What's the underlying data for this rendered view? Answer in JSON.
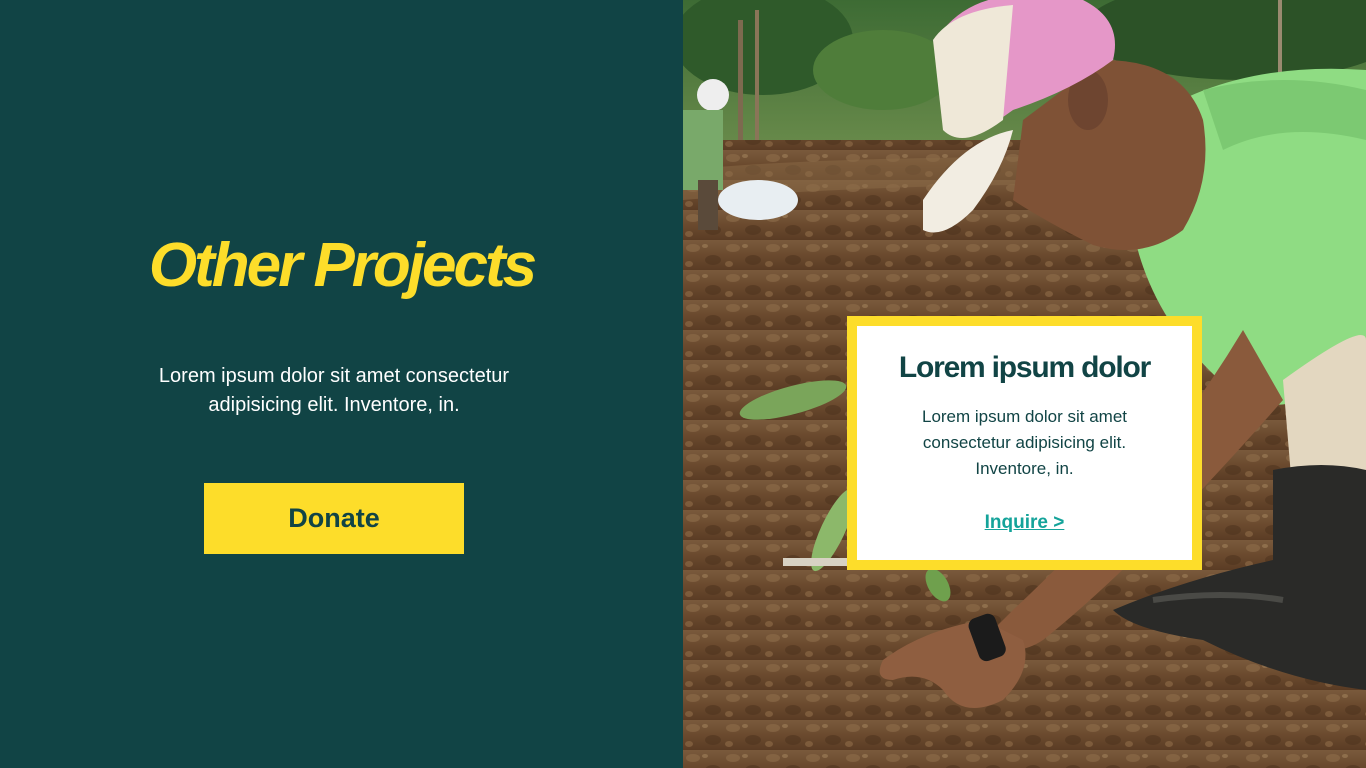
{
  "colors": {
    "panel": "#114445",
    "accent": "#FDDD2A",
    "link": "#14A39A",
    "white": "#FFFFFF"
  },
  "hero": {
    "title": "Other Projects",
    "description": "Lorem ipsum dolor sit amet consectetur adipisicing elit. Inventore, in.",
    "donate_label": "Donate"
  },
  "photo": {
    "alt": "Farmer in a pink cap planting a seedling in tilled soil"
  },
  "card": {
    "title": "Lorem ipsum dolor",
    "text": "Lorem ipsum dolor sit amet consectetur adipisicing elit. Inventore, in.",
    "link_label": "Inquire >"
  }
}
